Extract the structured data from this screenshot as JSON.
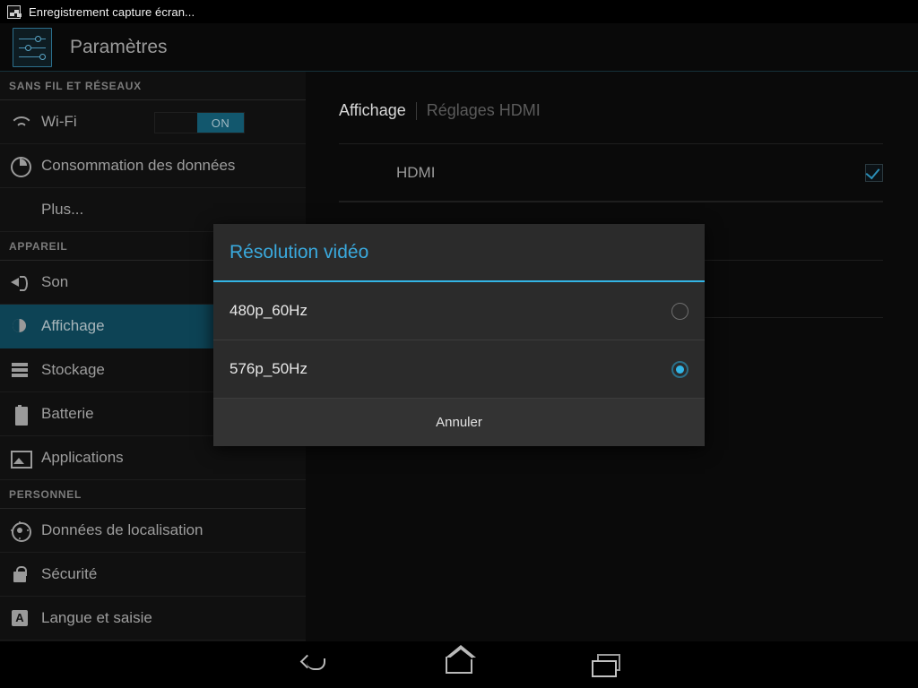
{
  "statusbar": {
    "notification_text": "Enregistrement capture écran...",
    "notification_icon": "screenshot-image-icon"
  },
  "appbar": {
    "title": "Paramètres",
    "icon": "settings-sliders-icon"
  },
  "sidebar": {
    "sections": [
      {
        "header": "SANS FIL ET RÉSEAUX",
        "items": [
          {
            "label": "Wi-Fi",
            "icon": "wifi-icon",
            "toggle": "ON",
            "selected": false
          },
          {
            "label": "Consommation des données",
            "icon": "data-usage-icon",
            "selected": false
          },
          {
            "label": "Plus...",
            "icon": "none",
            "selected": false
          }
        ]
      },
      {
        "header": "APPAREIL",
        "items": [
          {
            "label": "Son",
            "icon": "sound-icon",
            "selected": false
          },
          {
            "label": "Affichage",
            "icon": "display-brightness-icon",
            "selected": true
          },
          {
            "label": "Stockage",
            "icon": "storage-icon",
            "selected": false
          },
          {
            "label": "Batterie",
            "icon": "battery-icon",
            "selected": false
          },
          {
            "label": "Applications",
            "icon": "applications-icon",
            "selected": false
          }
        ]
      },
      {
        "header": "PERSONNEL",
        "items": [
          {
            "label": "Données de localisation",
            "icon": "location-icon",
            "selected": false
          },
          {
            "label": "Sécurité",
            "icon": "lock-icon",
            "selected": false
          },
          {
            "label": "Langue et saisie",
            "icon": "language-icon",
            "selected": false
          }
        ]
      }
    ]
  },
  "content": {
    "breadcrumb": {
      "active": "Affichage",
      "inactive": "Réglages HDMI"
    },
    "preferences": [
      {
        "label": "HDMI",
        "control": "checkbox",
        "checked": true
      }
    ]
  },
  "dialog": {
    "title": "Résolution vidéo",
    "options": [
      {
        "label": "480p_60Hz",
        "selected": false
      },
      {
        "label": "576p_50Hz",
        "selected": true
      }
    ],
    "cancel_label": "Annuler"
  },
  "navbar": {
    "buttons": [
      {
        "name": "back",
        "icon": "back-arrow-icon"
      },
      {
        "name": "home",
        "icon": "home-icon"
      },
      {
        "name": "recent",
        "icon": "recent-apps-icon"
      }
    ]
  },
  "colors": {
    "accent": "#33b5e5",
    "selected_row": "#0d4355",
    "toggle_on": "#12576d",
    "dialog_bg": "#2b2b2b"
  }
}
